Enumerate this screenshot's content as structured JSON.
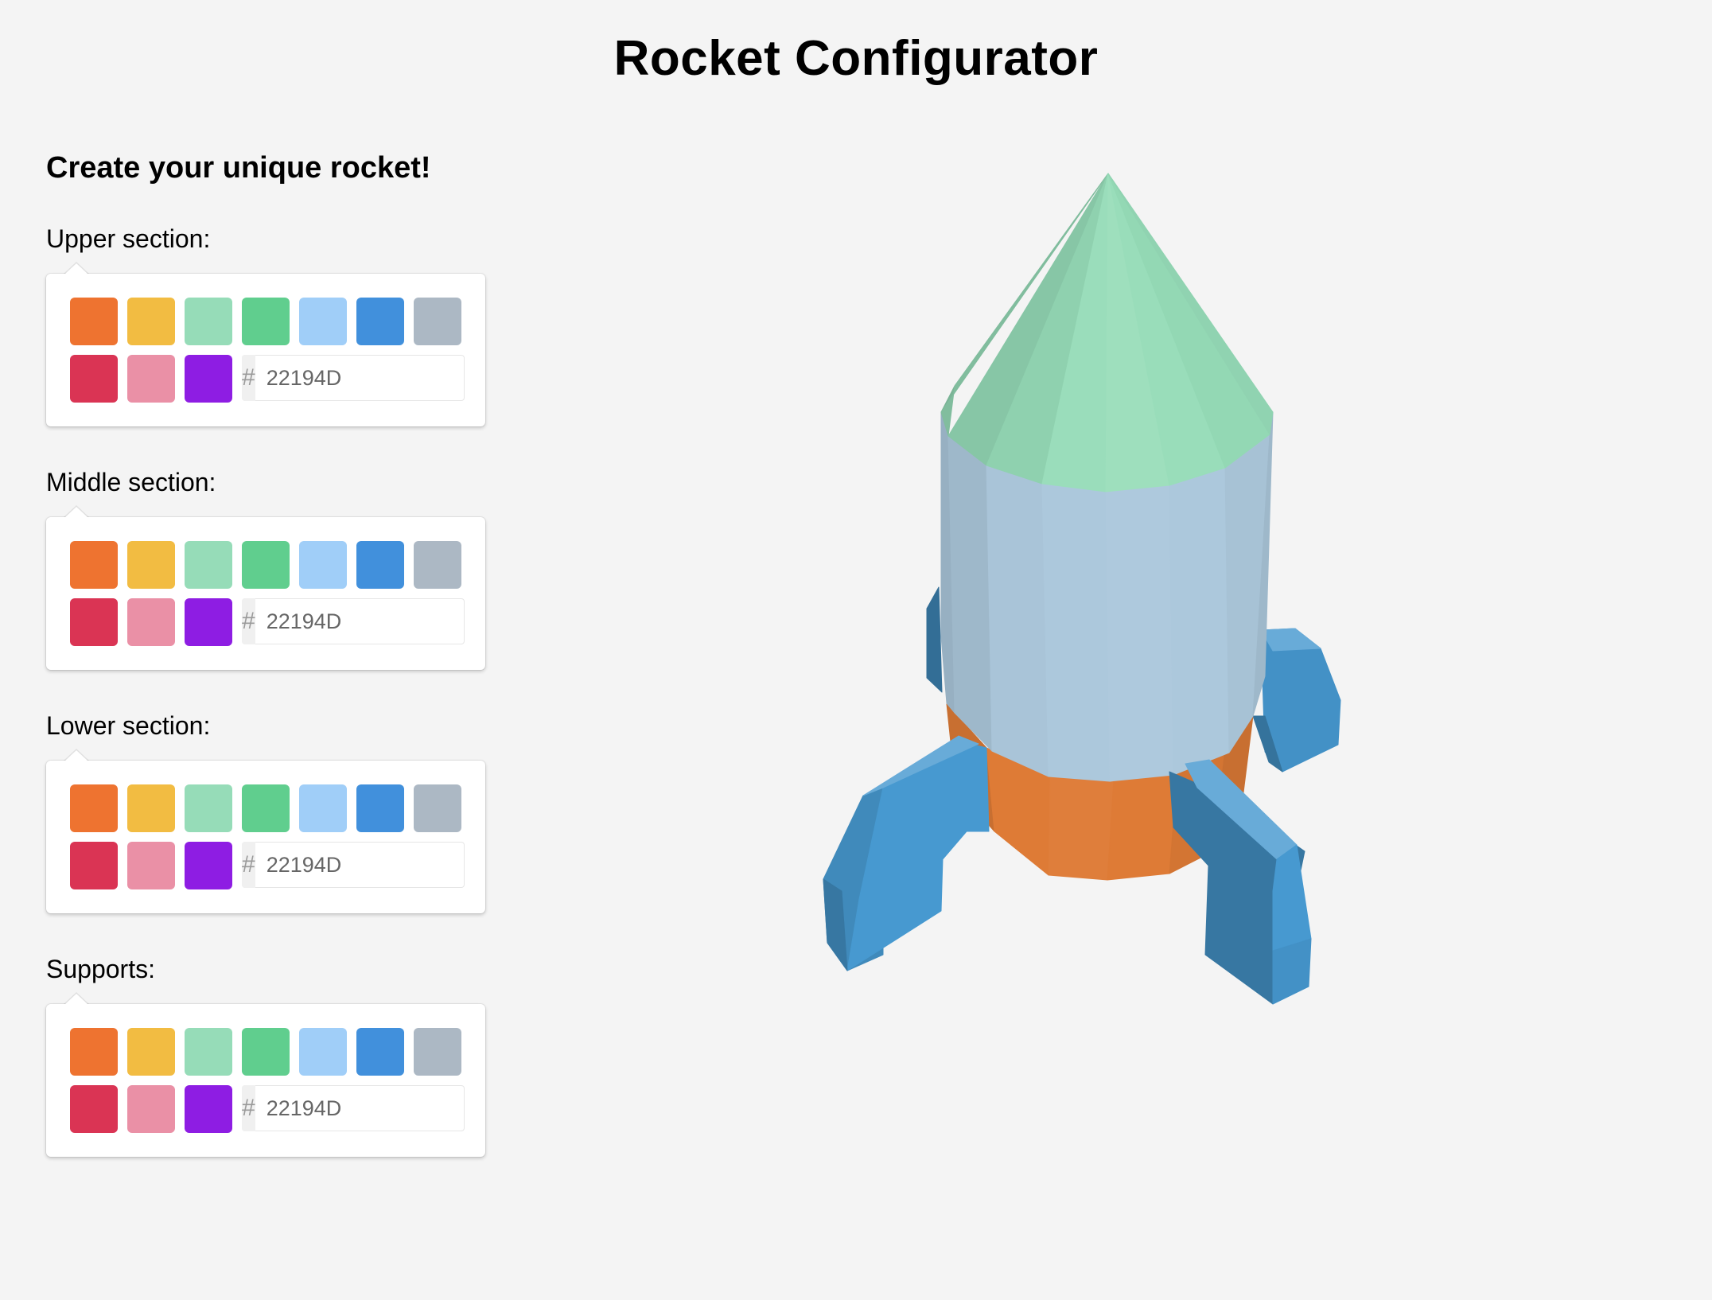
{
  "page": {
    "title": "Rocket Configurator"
  },
  "panel": {
    "subtitle": "Create your unique rocket!"
  },
  "palette": [
    "#EE7330",
    "#F2BC42",
    "#96DCB8",
    "#60CE8E",
    "#A0CEF8",
    "#4190DC",
    "#ACB8C4",
    "#DA3454",
    "#EA90A6",
    "#8E1DE3"
  ],
  "sections": [
    {
      "id": "upper",
      "label": "Upper section:",
      "hex_hash": "#",
      "hex_value": "22194D"
    },
    {
      "id": "middle",
      "label": "Middle section:",
      "hex_hash": "#",
      "hex_value": "22194D"
    },
    {
      "id": "lower",
      "label": "Lower section:",
      "hex_hash": "#",
      "hex_value": "22194D"
    },
    {
      "id": "supports",
      "label": "Supports:",
      "hex_hash": "#",
      "hex_value": "22194D"
    }
  ],
  "rocket_colors": {
    "upper": "#96DCB8",
    "middle": "#ACC8DC",
    "lower": "#DE7B36",
    "supports": "#4799D0"
  }
}
